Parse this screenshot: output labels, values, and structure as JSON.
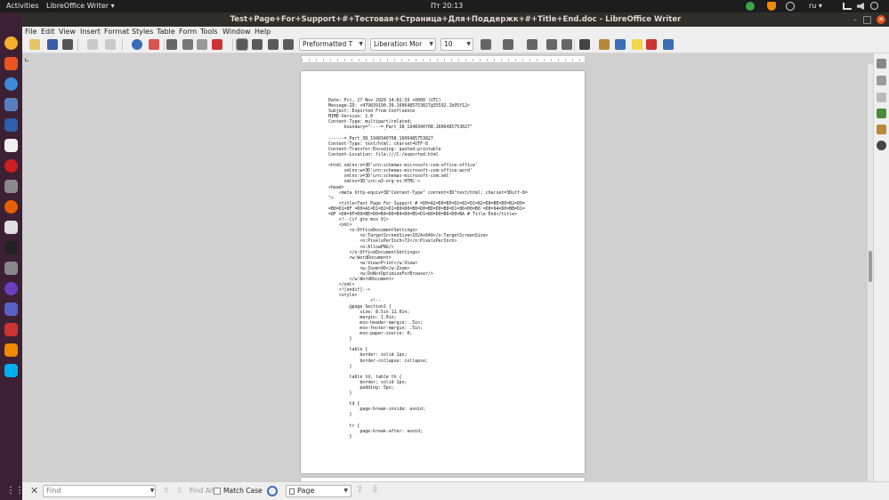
{
  "topbar": {
    "activities": "Activities",
    "app_menu": "LibreOffice Writer ▾",
    "clock": "Пт 20:13",
    "language": "ru ▾"
  },
  "window": {
    "title": "Test+Page+For+Support+#+Тестовая+Страница+Для+Поддержк+#+Title+End.doc - LibreOffice Writer"
  },
  "menu": {
    "items": [
      "File",
      "Edit",
      "View",
      "Insert",
      "Format",
      "Styles",
      "Table",
      "Form",
      "Tools",
      "Window",
      "Help"
    ]
  },
  "toolbar": {
    "paragraph_style": "Preformatted T",
    "font_name": "Liberation Mor",
    "font_size": "10"
  },
  "document": {
    "lines": [
      "Date: Fri, 27 Nov 2020 14:02:33 +0000 (UTC)",
      "Message-ID: <479839190.39.1606485753827@35592.1b95f12>",
      "Subject: Exported From Confluence",
      "MIME-Version: 1.0",
      "Content-Type: multipart/related;",
      "      boundary=\"----=_Part_38_1948340708.1606485753827\"",
      "",
      "------=_Part_38_1948340708.1606485753827",
      "Content-Type: text/html; charset=UTF-8",
      "Content-Transfer-Encoding: quoted-printable",
      "Content-Location: file:///C:/exported.html",
      "",
      "<html xmlns:o=3D'urn:schemas-microsoft-com:office:office'",
      "      xmlns:w=3D'urn:schemas-microsoft-com:office:word'",
      "      xmlns:v=3D'urn:schemas-microsoft-com:vml'",
      "      xmlns=3D'urn:w3-org-ns:HTML'>",
      "<head>",
      "    <meta http-equiv=3D\"Content-Type\" content=3D\"text/html; charset=3Dutf-8=",
      "\">",
      "    <title>Test Page For Support # =D0=A2=D0=B5=D1=81=D1=82=D0=BE=D0=B2=D0=",
      "=B0=D1=8F =D0=A1=D1=82=D1=80=D0=B0=D0=BD=D0=B8=D1=86=D0=B0 =D0=94=D0=BB=D1=",
      "=8F =D0=9F=D0=BE=D0=B4=D0=B4=D0=B5=D1=80=D0=B6=D0=BA # Title End</title>",
      "    <!--[if gte mso 9]>",
      "    <xml>",
      "        <o:OfficeDocumentSettings>",
      "            <o:TargetScreenSize>1024x640</o:TargetScreenSize>",
      "            <o:PixelsPerInch>72</o:PixelsPerInch>",
      "            <o:AllowPNG/>",
      "        </o:OfficeDocumentSettings>",
      "        <w:WordDocument>",
      "            <w:View>Print</w:View>",
      "            <w:Zoom>90</w:Zoom>",
      "            <w:DoNotOptimizeForBrowser/>",
      "        </w:WordDocument>",
      "    </xml>",
      "    <![endif]-->",
      "    <style>",
      "                <!--",
      "        @page Section1 {",
      "            size: 8.5in 11.0in;",
      "            margin: 1.0in;",
      "            mso-header-margin: .5in;",
      "            mso-footer-margin: .5in;",
      "            mso-paper-source: 0;",
      "        }",
      "",
      "        table {",
      "            border: solid 1px;",
      "            border-collapse: collapse;",
      "        }",
      "",
      "        table td, table th {",
      "            border: solid 1px;",
      "            padding: 5px;",
      "        }",
      "",
      "        td {",
      "            page-break-inside: avoid;",
      "        }",
      "",
      "        tr {",
      "            page-break-after: avoid;",
      "        }"
    ]
  },
  "findbar": {
    "placeholder": "Find",
    "find_all": "Find All",
    "match_case": "Match Case",
    "search_type": "Page"
  }
}
